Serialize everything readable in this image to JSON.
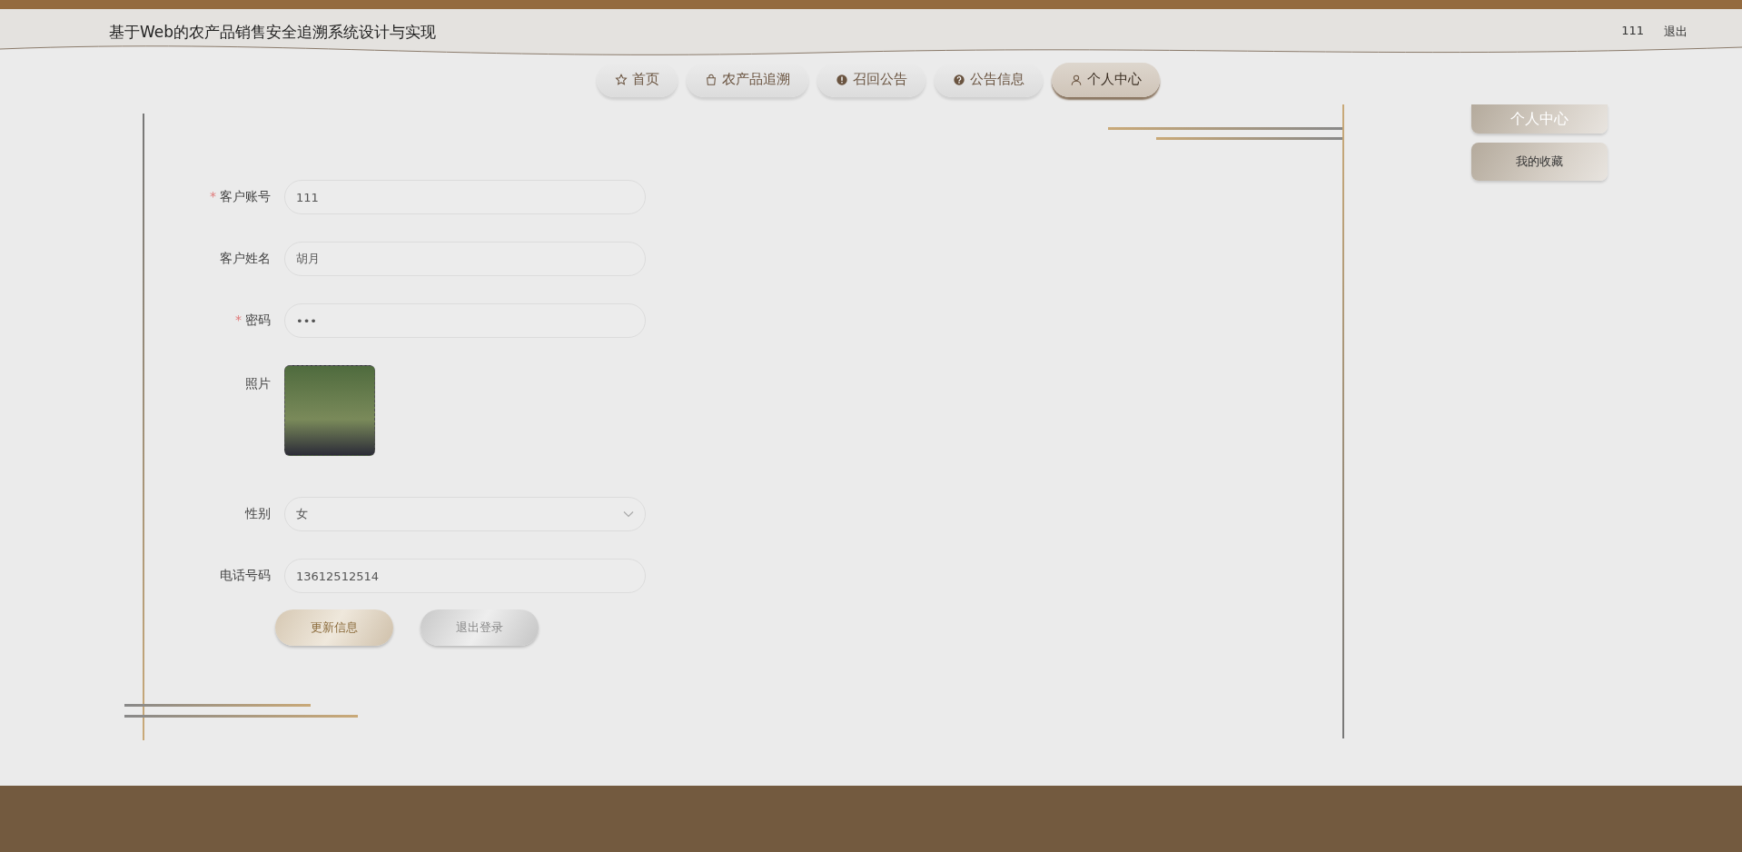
{
  "header": {
    "title": "基于Web的农产品销售安全追溯系统设计与实现",
    "user": "111",
    "logout": "退出"
  },
  "nav": [
    {
      "label": "首页",
      "selected": false
    },
    {
      "label": "农产品追溯",
      "selected": false
    },
    {
      "label": "召回公告",
      "selected": false
    },
    {
      "label": "公告信息",
      "selected": false
    },
    {
      "label": "个人中心",
      "selected": true
    }
  ],
  "form": {
    "fields": [
      {
        "kind": "text",
        "label": "客户账号",
        "required_mark": "*",
        "value": "111"
      },
      {
        "kind": "text",
        "label": "客户姓名",
        "value": "胡月"
      },
      {
        "kind": "password",
        "label": "密码",
        "required_mark": "*",
        "value": "•••"
      },
      {
        "kind": "image",
        "label": "照片"
      },
      {
        "kind": "select",
        "label": "性别",
        "value": "女"
      },
      {
        "kind": "text",
        "label": "电话号码",
        "value": "13612512514"
      }
    ],
    "buttons": [
      {
        "kind": "primary",
        "label": "更新信息"
      },
      {
        "kind": "secondary",
        "label": "退出登录"
      }
    ]
  },
  "sidebar": {
    "items": [
      {
        "label": "个人中心",
        "selected": true
      },
      {
        "label": "我的收藏",
        "selected": false
      }
    ]
  }
}
